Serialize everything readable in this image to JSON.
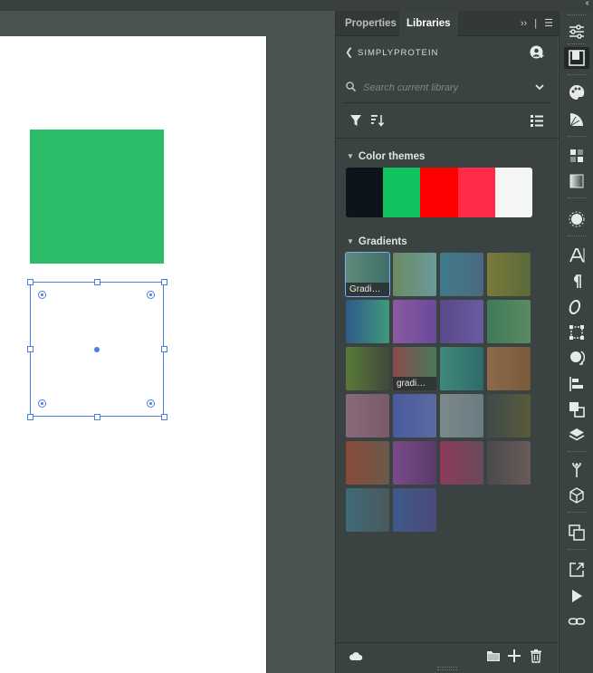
{
  "tabs": {
    "properties": "Properties",
    "libraries": "Libraries"
  },
  "library": {
    "name": "SIMPLYPROTEIN"
  },
  "search": {
    "placeholder": "Search current library"
  },
  "color_themes": {
    "title": "Color themes",
    "colors": [
      "#0e141c",
      "#12c25e",
      "#ff0000",
      "#ff2b47",
      "#f4f5f5"
    ]
  },
  "gradients": {
    "title": "Gradients",
    "tiles": [
      {
        "label": "Gradi…",
        "from": "#5d8a7a",
        "to": "#3f6f6a"
      },
      {
        "label": "",
        "from": "#6a8a62",
        "to": "#6a9a9a"
      },
      {
        "label": "",
        "from": "#3f7a8a",
        "to": "#4a6a82"
      },
      {
        "label": "",
        "from": "#7a7a3a",
        "to": "#5a6a3a"
      },
      {
        "label": "",
        "from": "#2f5a8a",
        "to": "#3f9a7a"
      },
      {
        "label": "",
        "from": "#8a5aa0",
        "to": "#6a4a9a"
      },
      {
        "label": "",
        "from": "#5a4a8a",
        "to": "#6a5aa0"
      },
      {
        "label": "",
        "from": "#3f7a5a",
        "to": "#5a8a62"
      },
      {
        "label": "",
        "from": "#5a7a3a",
        "to": "#3f4a3a"
      },
      {
        "label": "gradi…",
        "from": "#8a4a4a",
        "to": "#4a7a5a"
      },
      {
        "label": "",
        "from": "#3f8a7a",
        "to": "#2f6a6a"
      },
      {
        "label": "",
        "from": "#8a6a4a",
        "to": "#7a5a3a"
      },
      {
        "label": "",
        "from": "#8a6a7a",
        "to": "#7a5a6a"
      },
      {
        "label": "",
        "from": "#4a5aa0",
        "to": "#5a6aa0"
      },
      {
        "label": "",
        "from": "#7a8a8a",
        "to": "#6a7a82"
      },
      {
        "label": "",
        "from": "#3f4a4a",
        "to": "#5a5a3a"
      },
      {
        "label": "",
        "from": "#8a4a3a",
        "to": "#6a5a4a"
      },
      {
        "label": "",
        "from": "#7a4a8a",
        "to": "#5a3a6a"
      },
      {
        "label": "",
        "from": "#8a3a5a",
        "to": "#6a4a5a"
      },
      {
        "label": "",
        "from": "#4a4a4a",
        "to": "#6a5a5a"
      },
      {
        "label": "",
        "from": "#3f6a7a",
        "to": "#4a5a5a"
      },
      {
        "label": "",
        "from": "#3f5a8a",
        "to": "#4a4a7a"
      }
    ]
  },
  "canvas": {
    "fill_color": "#2dbd6a"
  }
}
